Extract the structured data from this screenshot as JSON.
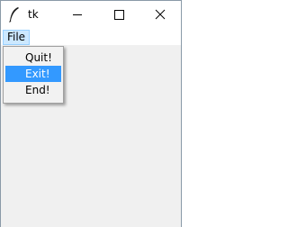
{
  "window": {
    "title": "tk"
  },
  "titlebar": {
    "icons": {
      "app": "feather-icon",
      "minimize": "minimize-icon",
      "maximize": "maximize-icon",
      "close": "close-icon"
    }
  },
  "menubar": {
    "items": [
      {
        "label": "File",
        "state": "open"
      }
    ]
  },
  "file_menu": {
    "items": [
      {
        "label": "Quit!",
        "selected": false
      },
      {
        "label": "Exit!",
        "selected": true
      },
      {
        "label": "End!",
        "selected": false
      }
    ]
  },
  "colors": {
    "client_background": "#f0f0f0",
    "menu_highlight": "#3399ff",
    "menubar_active": "#cce8ff"
  }
}
